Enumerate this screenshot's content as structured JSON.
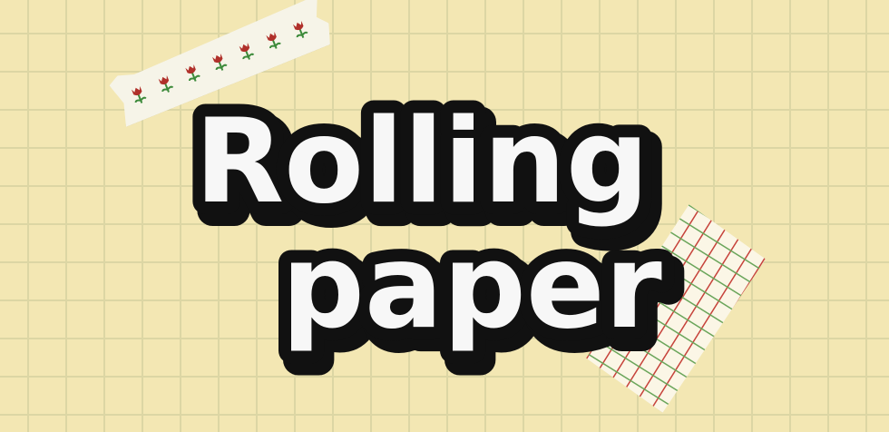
{
  "logo": {
    "line1": "Rolling",
    "line2": "paper"
  },
  "colors": {
    "background": "#f3e7b3",
    "grid": "#dcd6a4",
    "text_fill": "#f7f7f7",
    "text_outline": "#111111",
    "tulip_red": "#b0302a",
    "tulip_green": "#3c8a3a",
    "grid_tape_red": "#c6423a",
    "grid_tape_green": "#6aa55a"
  },
  "decorations": {
    "left_tape_icon": "tulip-icon",
    "right_tape_pattern": "plaid-grid"
  }
}
